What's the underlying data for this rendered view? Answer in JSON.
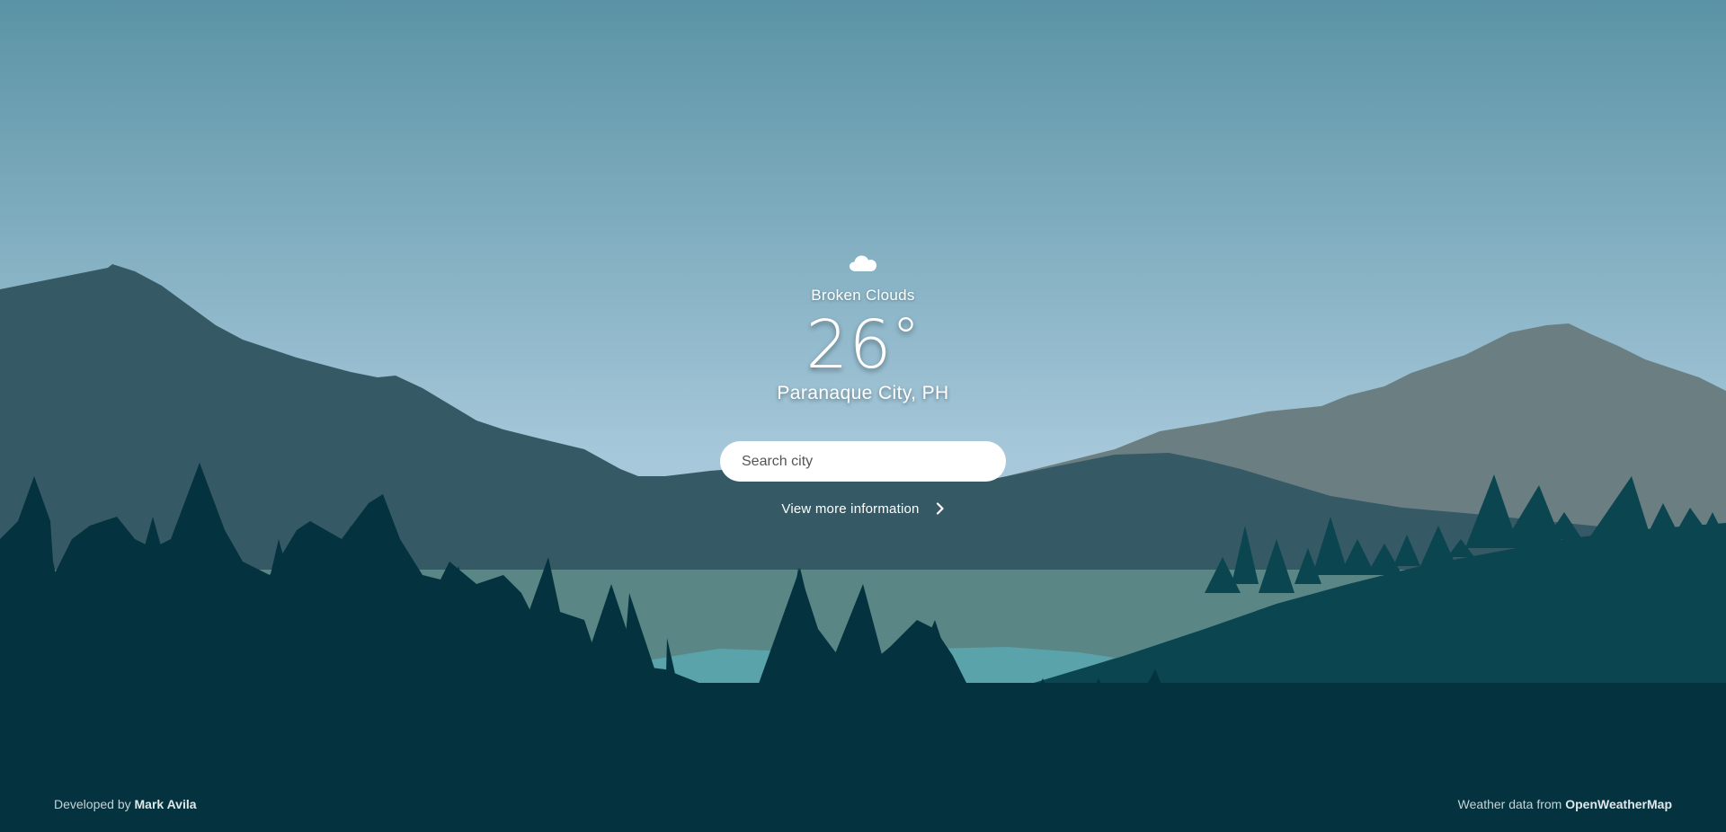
{
  "weather": {
    "icon": "cloud-icon",
    "condition": "Broken Clouds",
    "temperature": "26",
    "degree_symbol": "°",
    "location": "Paranaque City, PH"
  },
  "search": {
    "placeholder": "Search city",
    "value": ""
  },
  "more_info": {
    "label": "View more information",
    "icon": "chevron-right-icon"
  },
  "footer": {
    "left_prefix": "Developed by",
    "left_name": "Mark Avila",
    "right_prefix": "Weather data from",
    "right_name": "OpenWeatherMap"
  },
  "colors": {
    "sky_top": "#5a93a5",
    "sky_bottom": "#a6c8da",
    "far_mountain": "#6b7f82",
    "mid_mountain": "#355965",
    "lake": "#5b8686",
    "lake_highlight": "#5ba3ab",
    "forest_dark": "#04323f",
    "forest_mid": "#0a4550",
    "text": "#ffffff"
  }
}
